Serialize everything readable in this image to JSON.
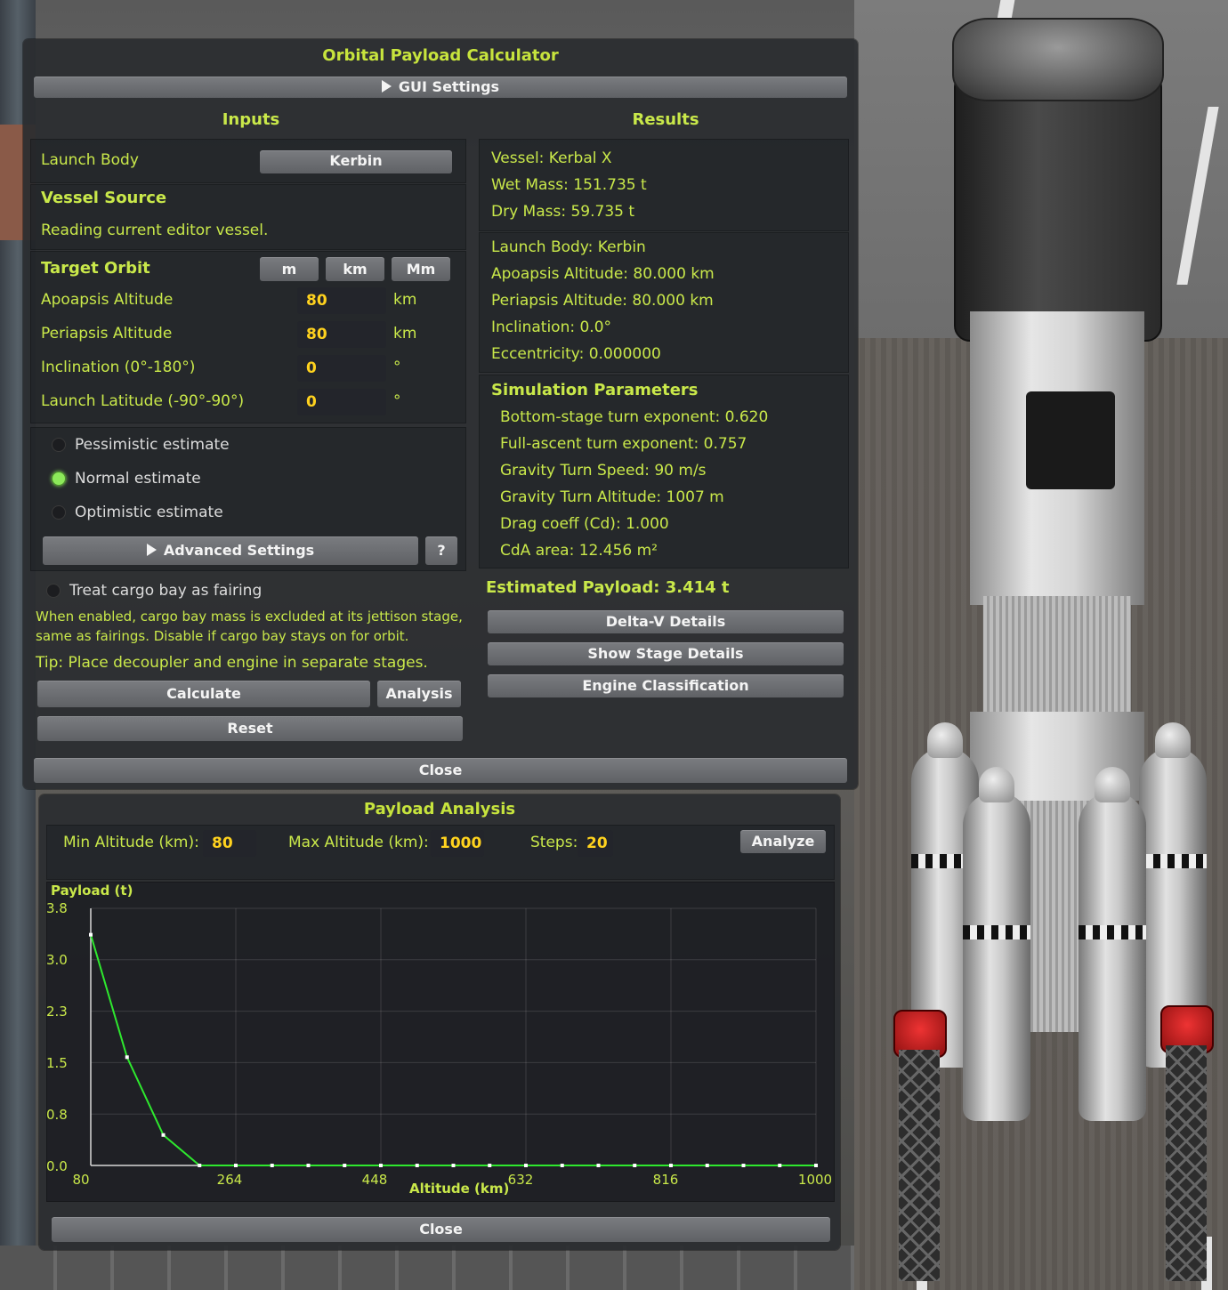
{
  "main_window": {
    "title": "Orbital Payload Calculator",
    "gui_settings_label": "GUI Settings",
    "inputs_header": "Inputs",
    "results_header": "Results",
    "launch_body_label": "Launch Body",
    "launch_body_value": "Kerbin",
    "vessel_source_label": "Vessel Source",
    "vessel_source_text": "Reading current editor vessel.",
    "target_orbit_label": "Target Orbit",
    "unit_buttons": [
      "m",
      "km",
      "Mm"
    ],
    "fields": [
      {
        "label": "Apoapsis Altitude",
        "value": "80",
        "unit": "km"
      },
      {
        "label": "Periapsis Altitude",
        "value": "80",
        "unit": "km"
      },
      {
        "label": "Inclination (0°-180°)",
        "value": "0",
        "unit": "°"
      },
      {
        "label": "Launch Latitude (-90°-90°)",
        "value": "0",
        "unit": "°"
      }
    ],
    "estimates": [
      {
        "label": "Pessimistic estimate",
        "selected": false
      },
      {
        "label": "Normal estimate",
        "selected": true
      },
      {
        "label": "Optimistic estimate",
        "selected": false
      }
    ],
    "advanced_settings_label": "Advanced Settings",
    "help_label": "?",
    "cargo_bay_label": "Treat cargo bay as fairing",
    "cargo_bay_note_1": "When enabled, cargo bay mass is excluded at its jettison stage,",
    "cargo_bay_note_2": "same as fairings. Disable if cargo bay stays on for orbit.",
    "tip": "Tip: Place decoupler and engine in separate stages.",
    "calculate_label": "Calculate",
    "analysis_label": "Analysis",
    "reset_label": "Reset",
    "close_label": "Close",
    "results": {
      "vessel": "Vessel: Kerbal X",
      "wet_mass": "Wet Mass: 151.735 t",
      "dry_mass": "Dry Mass: 59.735 t",
      "launch_body": "Launch Body: Kerbin",
      "apoapsis": "Apoapsis Altitude: 80.000 km",
      "periapsis": "Periapsis Altitude: 80.000 km",
      "inclination": "Inclination: 0.0°",
      "eccentricity": "Eccentricity: 0.000000",
      "sim_header": "Simulation Parameters",
      "sim_params": [
        "Bottom-stage turn exponent: 0.620",
        "Full-ascent turn exponent: 0.757",
        "Gravity Turn Speed: 90 m/s",
        "Gravity Turn Altitude: 1007 m",
        "Drag coeff (Cd): 1.000",
        "CdA area: 12.456 m²"
      ],
      "estimated_payload": "Estimated Payload: 3.414 t",
      "delta_v_label": "Delta-V Details",
      "stage_details_label": "Show Stage Details",
      "engine_class_label": "Engine Classification"
    }
  },
  "analysis_window": {
    "title": "Payload Analysis",
    "min_alt_label": "Min Altitude (km):",
    "min_alt_value": "80",
    "max_alt_label": "Max Altitude (km):",
    "max_alt_value": "1000",
    "steps_label": "Steps:",
    "steps_value": "20",
    "analyze_label": "Analyze",
    "close_label": "Close"
  },
  "chart_data": {
    "type": "line",
    "title": "",
    "xlabel": "Altitude (km)",
    "ylabel": "Payload (t)",
    "xlim": [
      80,
      1000
    ],
    "ylim": [
      0.0,
      3.8
    ],
    "x_ticks": [
      "80",
      "264",
      "448",
      "632",
      "816",
      "1000"
    ],
    "y_ticks": [
      "3.8",
      "3.0",
      "2.3",
      "1.5",
      "0.8",
      "0.0"
    ],
    "grid": true,
    "line_color": "#2ee82e",
    "x": [
      80,
      126,
      172,
      218,
      264,
      310,
      356,
      402,
      448,
      494,
      540,
      586,
      632,
      678,
      724,
      770,
      816,
      862,
      908,
      954,
      1000
    ],
    "values": [
      3.41,
      1.6,
      0.45,
      0.0,
      0.0,
      0.0,
      0.0,
      0.0,
      0.0,
      0.0,
      0.0,
      0.0,
      0.0,
      0.0,
      0.0,
      0.0,
      0.0,
      0.0,
      0.0,
      0.0,
      0.0
    ]
  }
}
